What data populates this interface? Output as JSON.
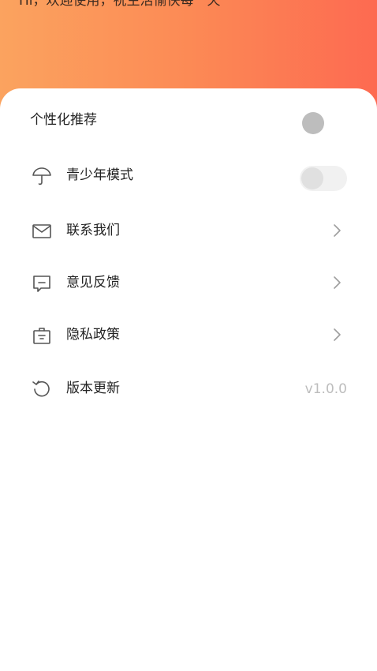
{
  "header": {
    "greeting": "Hi，欢迎使用，祝生活愉快每一天"
  },
  "settings": {
    "personalized": {
      "label": "个性化推荐",
      "state": "off"
    },
    "items": [
      {
        "icon": "umbrella-icon",
        "label": "青少年模式",
        "type": "toggle",
        "state": "off"
      },
      {
        "icon": "mail-icon",
        "label": "联系我们",
        "type": "link"
      },
      {
        "icon": "feedback-icon",
        "label": "意见反馈",
        "type": "link"
      },
      {
        "icon": "privacy-icon",
        "label": "隐私政策",
        "type": "link"
      },
      {
        "icon": "refresh-icon",
        "label": "版本更新",
        "type": "value",
        "value": "v1.0.0"
      }
    ]
  }
}
